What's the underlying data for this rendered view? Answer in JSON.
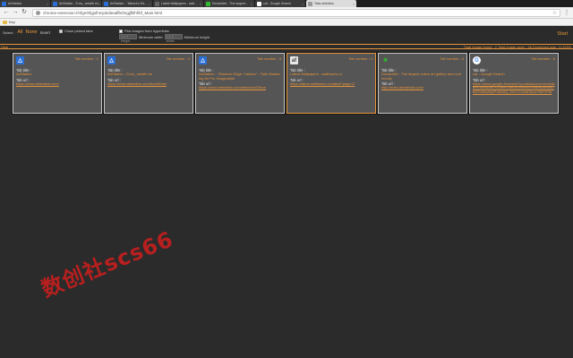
{
  "browser": {
    "tabs": [
      {
        "title": "ArtStation",
        "color": "#2a6fd6",
        "active": false
      },
      {
        "title": "ArtStation - D.ea_ wealth ee",
        "color": "#2a6fd6",
        "active": false
      },
      {
        "title": "ArtStation - \"Minera's Ed…",
        "color": "#2a6fd6",
        "active": false
      },
      {
        "title": "Latest Wallpapers - wall…",
        "color": "#666666",
        "active": false
      },
      {
        "title": "DeviantArt - The largest…",
        "color": "#2eb82e",
        "active": false
      },
      {
        "title": "cat - Google Search",
        "color": "#ffffff",
        "active": false
      },
      {
        "title": "Tabs selection",
        "color": "#999999",
        "active": true
      }
    ],
    "url": "chrome-extension://nfgmhfgjolhmjokdieadfbrlmgjjfklhf/bf_Main.html",
    "bookmarks": [
      {
        "label": "Key"
      }
    ]
  },
  "controls": {
    "select_label": "Select :",
    "select_all": "All",
    "select_none": "None",
    "select_invert": "Invert",
    "close_picked_label": "Close picked tabs",
    "pick_hyperlinks_label": "Pick images from hyperlinks",
    "min_width_placeholder": "1-1-1 Height",
    "min_width_label": "Minimum width",
    "min_height_placeholder": "1-1-1 Width",
    "min_height_label": "Minimum height",
    "start_label": "Start"
  },
  "stats": {
    "left": "Help",
    "right": "Total image found : 2  Total image seen : 66  Download size : 6.413%"
  },
  "labels": {
    "tab_title": "Tab title :",
    "tab_url": "Tab url :",
    "tab_number_prefix": "Tab number : "
  },
  "cards": [
    {
      "number": "1",
      "icon": "artstation-icon",
      "icon_char": "△",
      "icon_bg": "#2a6fd6",
      "icon_fg": "#ffffff",
      "title": "ArtStation",
      "url": "https://www.artstation.com/",
      "selected": false
    },
    {
      "number": "2",
      "icon": "artstation-icon",
      "icon_char": "△",
      "icon_bg": "#2a6fd6",
      "icon_fg": "#ffffff",
      "title": "ArtStation - D.ea_ wealth ee",
      "url": "https://www.artstation.com/leoeftimiel",
      "selected": false
    },
    {
      "number": "3",
      "icon": "artstation-icon",
      "icon_char": "△",
      "icon_bg": "#2a6fd6",
      "icon_fg": "#ffffff",
      "title": "ArtStation - \"Minera's Edge: Cataluz\" - Faith-Balancing Art For Imagination",
      "url": "https://www.artstation.com/artwork/nD9mn",
      "selected": false
    },
    {
      "number": "4",
      "icon": "wallpaper-icon",
      "icon_char": "af",
      "icon_bg": "#e8e8e8",
      "icon_fg": "#444444",
      "title": "Latest Wallpapers - wallhaven.cc",
      "url": "https://alpha.wallhaven.cc/latest?page=2",
      "selected": true
    },
    {
      "number": "5",
      "icon": "deviantart-icon",
      "icon_char": "✖",
      "icon_bg": "#555555",
      "icon_fg": "#2eb82e",
      "title": "DeviantArt - The largest online art gallery and community",
      "url": "http://www.deviantart.com/",
      "selected": false
    },
    {
      "number": "6",
      "icon": "google-icon",
      "icon_char": "G",
      "icon_bg": "#ffffff",
      "icon_fg": "#4285f4",
      "title": "cat - Google Search",
      "url": "https://www.google.fr/search?q=cat&source=lnms&tbm=isch&sa=X&ved=0ahUKEwi4v8XHt8HbAhWkDBdYlvBwAbyFh3AIAQ_WCCCo4ADhpxr7M5YPAI",
      "selected": false
    }
  ],
  "watermark": "数创社scs66"
}
